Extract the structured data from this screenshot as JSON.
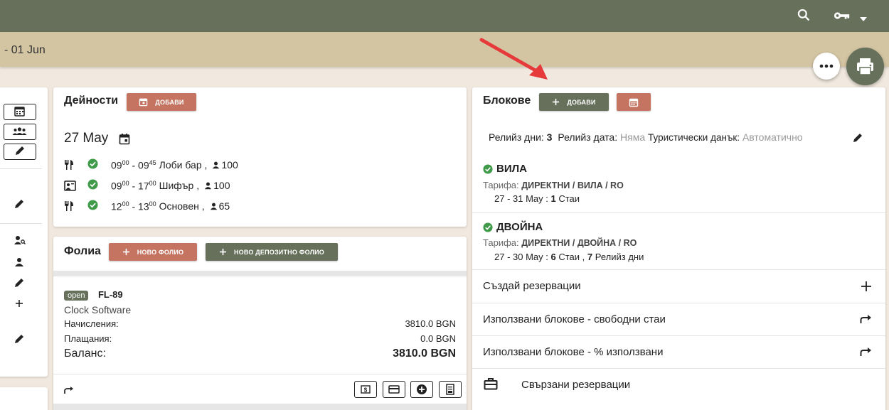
{
  "header": {
    "date_range": "- 01 Jun",
    "icons": [
      "search-icon",
      "key-icon",
      "caret-down-icon"
    ],
    "colors": {
      "topbar": "#66705a",
      "subbar": "#d3c4a2",
      "accent_red": "#c57462",
      "accent_green": "#66705a"
    }
  },
  "activities": {
    "title": "Дейности",
    "add_label": "ДОБАВИ",
    "date": "27 May",
    "rows": [
      {
        "icon": "cutlery-icon",
        "start_h": "09",
        "start_m": "00",
        "end_h": "09",
        "end_m": "45",
        "name": "Лоби бар ,",
        "count": "100"
      },
      {
        "icon": "presentation-icon",
        "start_h": "09",
        "start_m": "00",
        "end_h": "17",
        "end_m": "00",
        "name": "Шифър ,",
        "count": "100"
      },
      {
        "icon": "cutlery-icon",
        "start_h": "12",
        "start_m": "00",
        "end_h": "13",
        "end_m": "00",
        "name": "Основен ,",
        "count": "65"
      }
    ]
  },
  "folios": {
    "title": "Фолиа",
    "new_folio_label": "НОВО ФОЛИО",
    "new_deposit_label": "НОВО ДЕПОЗИТНО ФОЛИО",
    "folio": {
      "status": "open",
      "number": "FL-89",
      "company": "Clock Software",
      "charges_label": "Начисления:",
      "charges_value": "3810.0 BGN",
      "payments_label": "Плащания:",
      "payments_value": "0.0 BGN",
      "balance_label": "Баланс:",
      "balance_value": "3810.0 BGN"
    }
  },
  "blocks": {
    "title": "Блокове",
    "add_label": "ДОБАВИ",
    "release_days_label": "Релийз дни:",
    "release_days_value": "3",
    "release_date_label": "Релийз дата:",
    "release_date_value": "Няма",
    "tourist_tax_label": "Туристически данък:",
    "tourist_tax_value": "Автоматично",
    "items": [
      {
        "name": "ВИЛА",
        "rate_label": "Тарифа:",
        "rate": "ДИРЕКТНИ / ВИЛА / RO",
        "range": "27 - 31 May :",
        "rooms": "1",
        "rooms_label": "Стаи",
        "extra_sep": "",
        "release": "",
        "release_label": ""
      },
      {
        "name": "ДВОЙНА",
        "rate_label": "Тарифа:",
        "rate": "ДИРЕКТНИ / ДВОЙНА / RO",
        "range": "27 - 30 May :",
        "rooms": "6",
        "rooms_label": "Стаи ,",
        "extra_sep": "",
        "release": "7",
        "release_label": "Релийз дни"
      }
    ],
    "menu": [
      "Създай резервации",
      "Използвани блокове - свободни стаи",
      "Използвани блокове - % използвани",
      "Свързани резервации"
    ]
  }
}
